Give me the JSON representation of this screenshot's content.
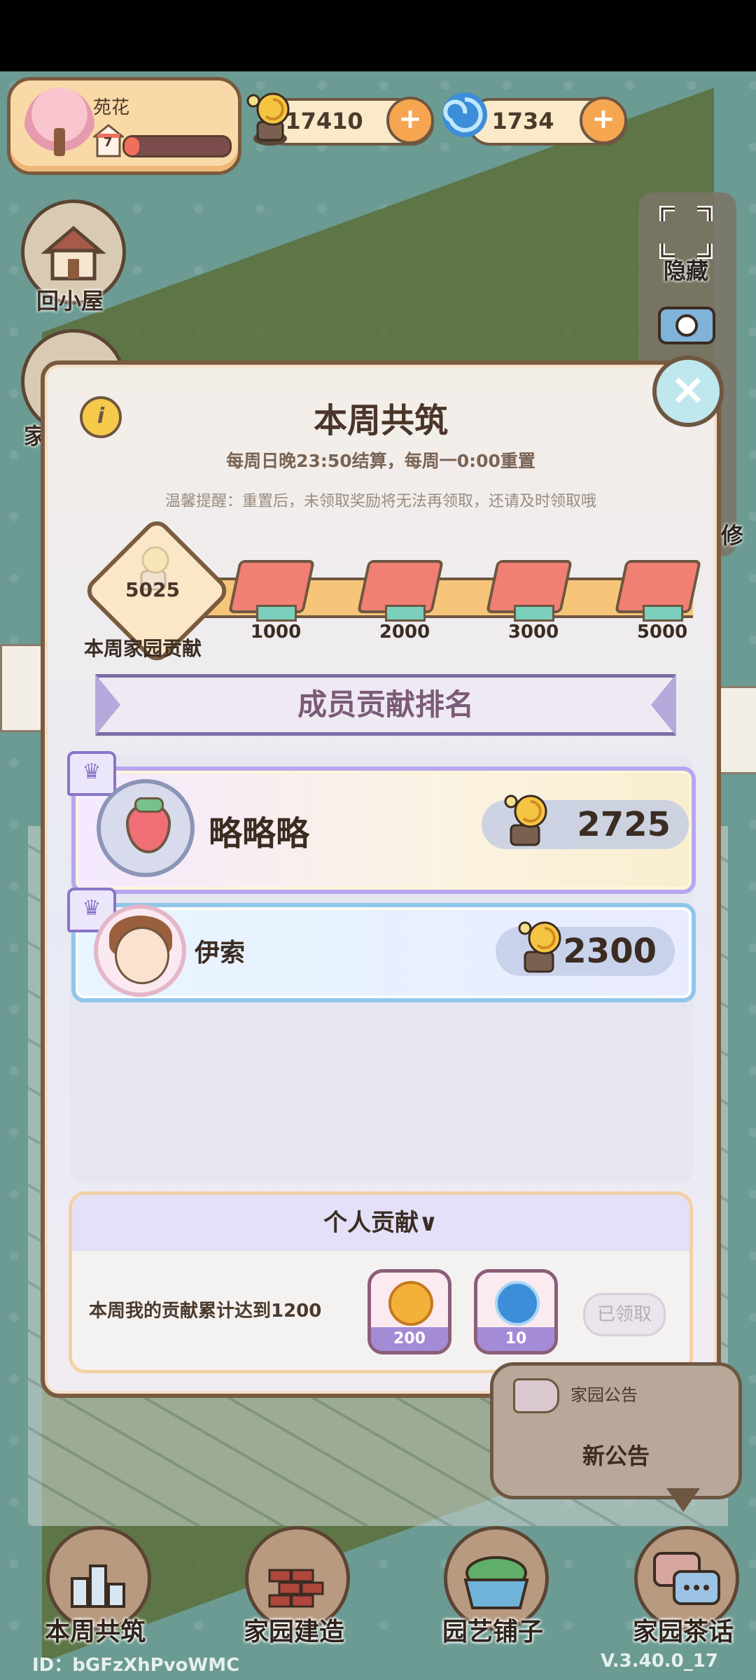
{
  "player": {
    "name": "苑花",
    "level": "7",
    "xp_progress": 0.14
  },
  "currencies": [
    {
      "name": "snail-coin",
      "value": "17410"
    },
    {
      "name": "blue-swirl",
      "value": "1734"
    }
  ],
  "side_buttons": {
    "home_label": "回小屋",
    "partial_home_label": "家"
  },
  "right_panel": {
    "hide_label": "隐藏",
    "photo_label": "拍照",
    "repair_label": "修"
  },
  "modal": {
    "title": "本周共筑",
    "schedule": "每周日晚23:50结算，每周一0:00重置",
    "tip": "温馨提醒：重置后，未领取奖励将无法再领取，还请及时领取哦",
    "weekly_contribution": {
      "value": "5025",
      "label": "本周家园贡献"
    },
    "milestones": [
      "1000",
      "2000",
      "3000",
      "5000"
    ],
    "ranking_title": "成员贡献排名",
    "members": [
      {
        "name": "略略略",
        "score": "2725",
        "avatar": "strawberry-avatar"
      },
      {
        "name": "伊索",
        "score": "2300",
        "avatar": "girl-avatar"
      }
    ],
    "personal": {
      "title": "个人贡献∨",
      "desc": "本周我的贡献累计达到1200",
      "rewards": [
        {
          "icon": "gold-coin",
          "qty": "200"
        },
        {
          "icon": "blue-swirl",
          "qty": "10"
        }
      ],
      "claim_label": "已领取"
    }
  },
  "announcement": {
    "small": "家园公告",
    "big": "新公告"
  },
  "nav": [
    {
      "label": "本周共筑",
      "icon": "podium-icon"
    },
    {
      "label": "家园建造",
      "icon": "bricks-icon"
    },
    {
      "label": "园艺铺子",
      "icon": "planter-icon"
    },
    {
      "label": "家园茶话",
      "icon": "chat-icon"
    }
  ],
  "footer": {
    "id": "ID：bGFzXhPvoWMC",
    "version": "V.3.40.0_17"
  },
  "colors": {
    "frame": "#7a5b3f",
    "accent": "#b7a6f0",
    "bg": "#6b9b93"
  }
}
